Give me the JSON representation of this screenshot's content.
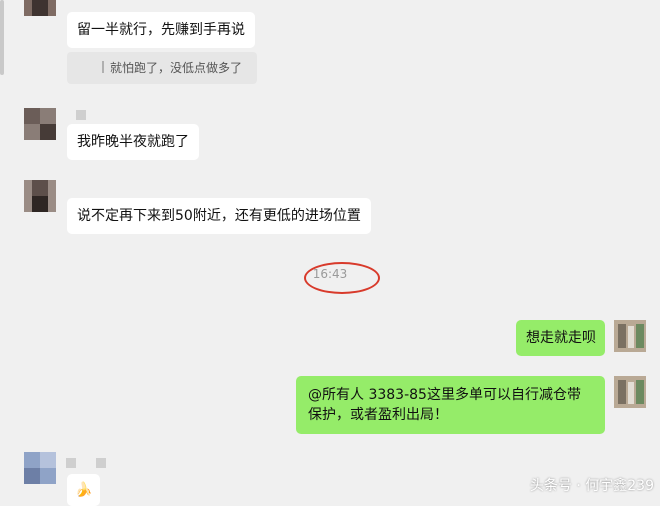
{
  "messages": [
    {
      "sender": "other",
      "text": "留一半就行，先赚到手再说",
      "quote": "就怕跑了，没低点做多了"
    },
    {
      "sender": "other",
      "text": "我昨晚半夜就跑了"
    },
    {
      "sender": "other",
      "text": "说不定再下来到50附近，还有更低的进场位置"
    },
    {
      "sender": "me",
      "text": "想走就走呗"
    },
    {
      "sender": "me",
      "text": "@所有人 3383-85这里多单可以自行减仓带保护，或者盈利出局！"
    },
    {
      "sender": "other",
      "text": "🍌"
    }
  ],
  "timestamp": "16:43",
  "watermark": "头条号 · 何宇鑫239",
  "colors": {
    "my_bubble": "#95ec69",
    "other_bubble": "#ffffff",
    "highlight_circle": "#d83a2b",
    "background": "#f0f0f0"
  }
}
